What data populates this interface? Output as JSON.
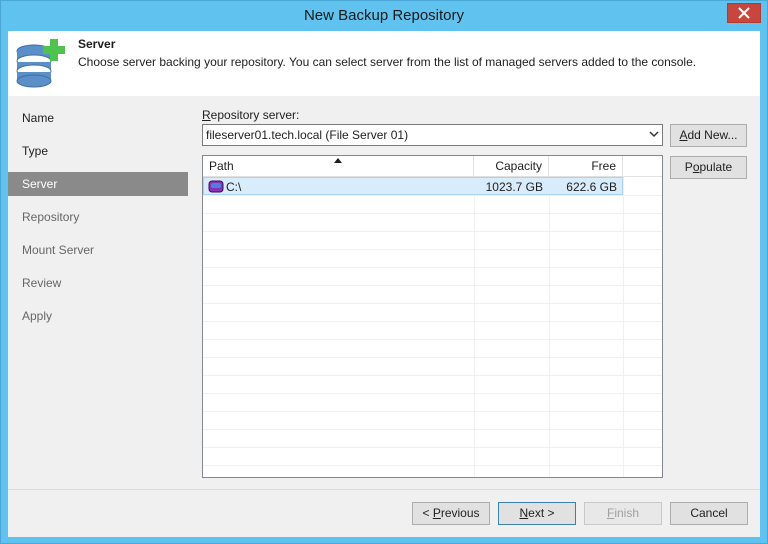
{
  "window": {
    "title": "New Backup Repository",
    "accent": "#60c2ee"
  },
  "header": {
    "title": "Server",
    "description": "Choose server backing your repository. You can select server from the list of managed servers added to the console.",
    "icon": "database-add-icon"
  },
  "steps": [
    {
      "label": "Name",
      "state": "done"
    },
    {
      "label": "Type",
      "state": "done"
    },
    {
      "label": "Server",
      "state": "active"
    },
    {
      "label": "Repository",
      "state": "future"
    },
    {
      "label": "Mount Server",
      "state": "future"
    },
    {
      "label": "Review",
      "state": "future"
    },
    {
      "label": "Apply",
      "state": "future"
    }
  ],
  "server": {
    "label_prefix": "R",
    "label_rest": "epository server:",
    "selected": "fileserver01.tech.local (File Server 01)",
    "add_new_prefix": "A",
    "add_new_rest": "dd New...",
    "populate_prefix": "P",
    "populate_u": "o",
    "populate_rest": "pulate"
  },
  "grid": {
    "columns": {
      "path": "Path",
      "capacity": "Capacity",
      "free": "Free"
    },
    "rows": [
      {
        "path": "C:\\",
        "capacity": "1023.7 GB",
        "free": "622.6 GB",
        "icon": "drive-icon"
      }
    ]
  },
  "footer": {
    "previous_pre": "< ",
    "previous_u": "P",
    "previous_rest": "revious",
    "next_u": "N",
    "next_rest": "ext >",
    "finish_u": "F",
    "finish_rest": "inish",
    "cancel": "Cancel"
  }
}
